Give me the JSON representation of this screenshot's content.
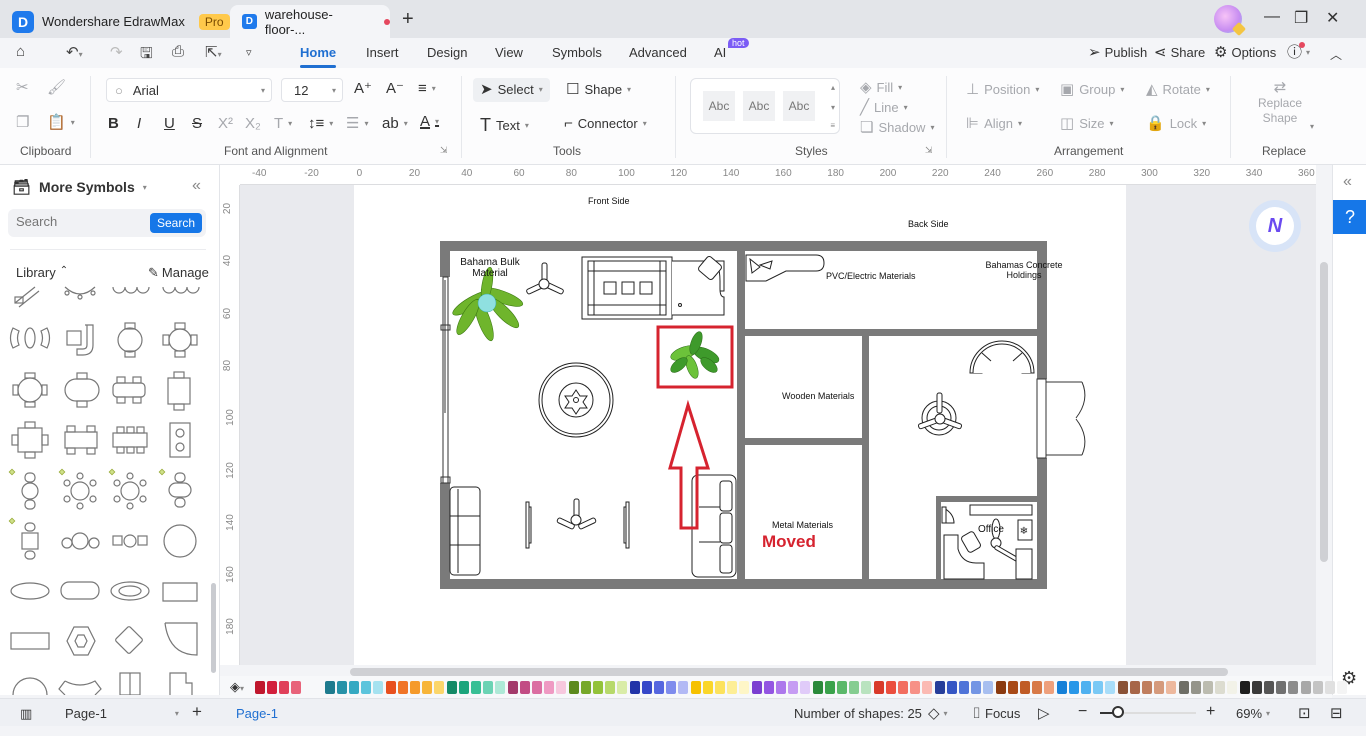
{
  "titlebar": {
    "app_name": "Wondershare EdrawMax",
    "badge": "Pro",
    "doc_tab": "warehouse-floor-...",
    "new_tab_icon": "+",
    "minimize": "—",
    "restore": "❐",
    "close": "✕"
  },
  "menubar": {
    "tabs": [
      "Home",
      "Insert",
      "Design",
      "View",
      "Symbols",
      "Advanced",
      "AI"
    ],
    "active_tab": "Home",
    "ai_badge": "hot",
    "right": {
      "publish": "Publish",
      "share": "Share",
      "options": "Options"
    }
  },
  "ribbon": {
    "groups": {
      "clipboard": "Clipboard",
      "font": "Font and Alignment",
      "tools": "Tools",
      "styles": "Styles",
      "arrangement": "Arrangement",
      "replace": "Replace"
    },
    "font_family": "Arial",
    "font_size": "12",
    "tools": {
      "select": "Select",
      "shape": "Shape",
      "text": "Text",
      "connector": "Connector"
    },
    "style_samples": [
      "Abc",
      "Abc",
      "Abc"
    ],
    "style_opts": {
      "fill": "Fill",
      "line": "Line",
      "shadow": "Shadow"
    },
    "arrange": {
      "position": "Position",
      "group": "Group",
      "rotate": "Rotate",
      "align": "Align",
      "size": "Size",
      "lock": "Lock"
    },
    "replace_shape": [
      "Replace",
      "Shape"
    ]
  },
  "leftpanel": {
    "title": "More Symbols",
    "search_placeholder": "Search",
    "search_button": "Search",
    "library_label": "Library",
    "manage_label": "Manage"
  },
  "rulers": {
    "h": [
      "-40",
      "-20",
      "0",
      "20",
      "40",
      "60",
      "80",
      "100",
      "120",
      "140",
      "160",
      "180",
      "200",
      "220",
      "240",
      "260",
      "280",
      "300",
      "320",
      "340",
      "360"
    ],
    "v": [
      "20",
      "40",
      "60",
      "80",
      "100",
      "120",
      "140",
      "160",
      "180"
    ]
  },
  "floorplan": {
    "front_side": "Front Side",
    "back_side": "Back Side",
    "rooms": {
      "bahama_bulk": "Bahama Bulk Material",
      "pvc": "PVC/Electric Materials",
      "bahamas_concrete": "Bahamas Concrete Holdings",
      "wooden": "Wooden Materials",
      "metal": "Metal Materials",
      "office": "Office"
    },
    "annotation": "Moved",
    "annotation_color": "#d6232f"
  },
  "palette": {
    "colors": [
      "#c0172d",
      "#d21f3c",
      "#e0405a",
      "#e8637a",
      "#1e7b8e",
      "#2792a8",
      "#35a9c2",
      "#5cc4dc",
      "#a6e2f0",
      "#e8501f",
      "#f07427",
      "#f59a2b",
      "#f7b53a",
      "#fbd66b",
      "#148a67",
      "#1ba57c",
      "#38bf95",
      "#6bd3b4",
      "#aee9d7",
      "#a33a6b",
      "#c24c84",
      "#db6ea2",
      "#ef9ac3",
      "#f7c8de",
      "#5c8a1d",
      "#76a82a",
      "#93c23a",
      "#b7d96b",
      "#d9eca8",
      "#2234a8",
      "#3648c9",
      "#5566df",
      "#7f8ced",
      "#b2b9f5",
      "#f6c100",
      "#fad62a",
      "#fce25d",
      "#fdee96",
      "#fef6c7",
      "#7b3fd1",
      "#9355e2",
      "#ad78ec",
      "#c69cf3",
      "#e0cbf9",
      "#2a8a3a",
      "#3aa24b",
      "#5bb86a",
      "#85cd91",
      "#b9e3bf",
      "#d93a2a",
      "#eb4e3e",
      "#f26e60",
      "#f79187",
      "#fbbab3",
      "#263e9a",
      "#3556c4",
      "#4f74d8",
      "#7395e4",
      "#a8bff0",
      "#8a3a10",
      "#a84a18",
      "#c05c26",
      "#d87a48",
      "#eea07c",
      "#1580d8",
      "#2897e8",
      "#4fb1f0",
      "#7ac9f5",
      "#a8ddf9",
      "#8a5236",
      "#a76648",
      "#c07e5e",
      "#d59a7c",
      "#edb89d",
      "#6e6e66",
      "#94948a",
      "#bcbcb0",
      "#dcdcd0",
      "#f2f2e8",
      "#1e1e1e",
      "#3a3a3a",
      "#555555",
      "#707070",
      "#8c8c8c",
      "#a8a8a8",
      "#c4c4c4",
      "#e0e0e0",
      "#f4f4f4"
    ]
  },
  "statusbar": {
    "page_dropdown": "Page-1",
    "active_page": "Page-1",
    "shape_count": "Number of shapes: 25",
    "focus": "Focus",
    "zoom_level": "69%"
  }
}
